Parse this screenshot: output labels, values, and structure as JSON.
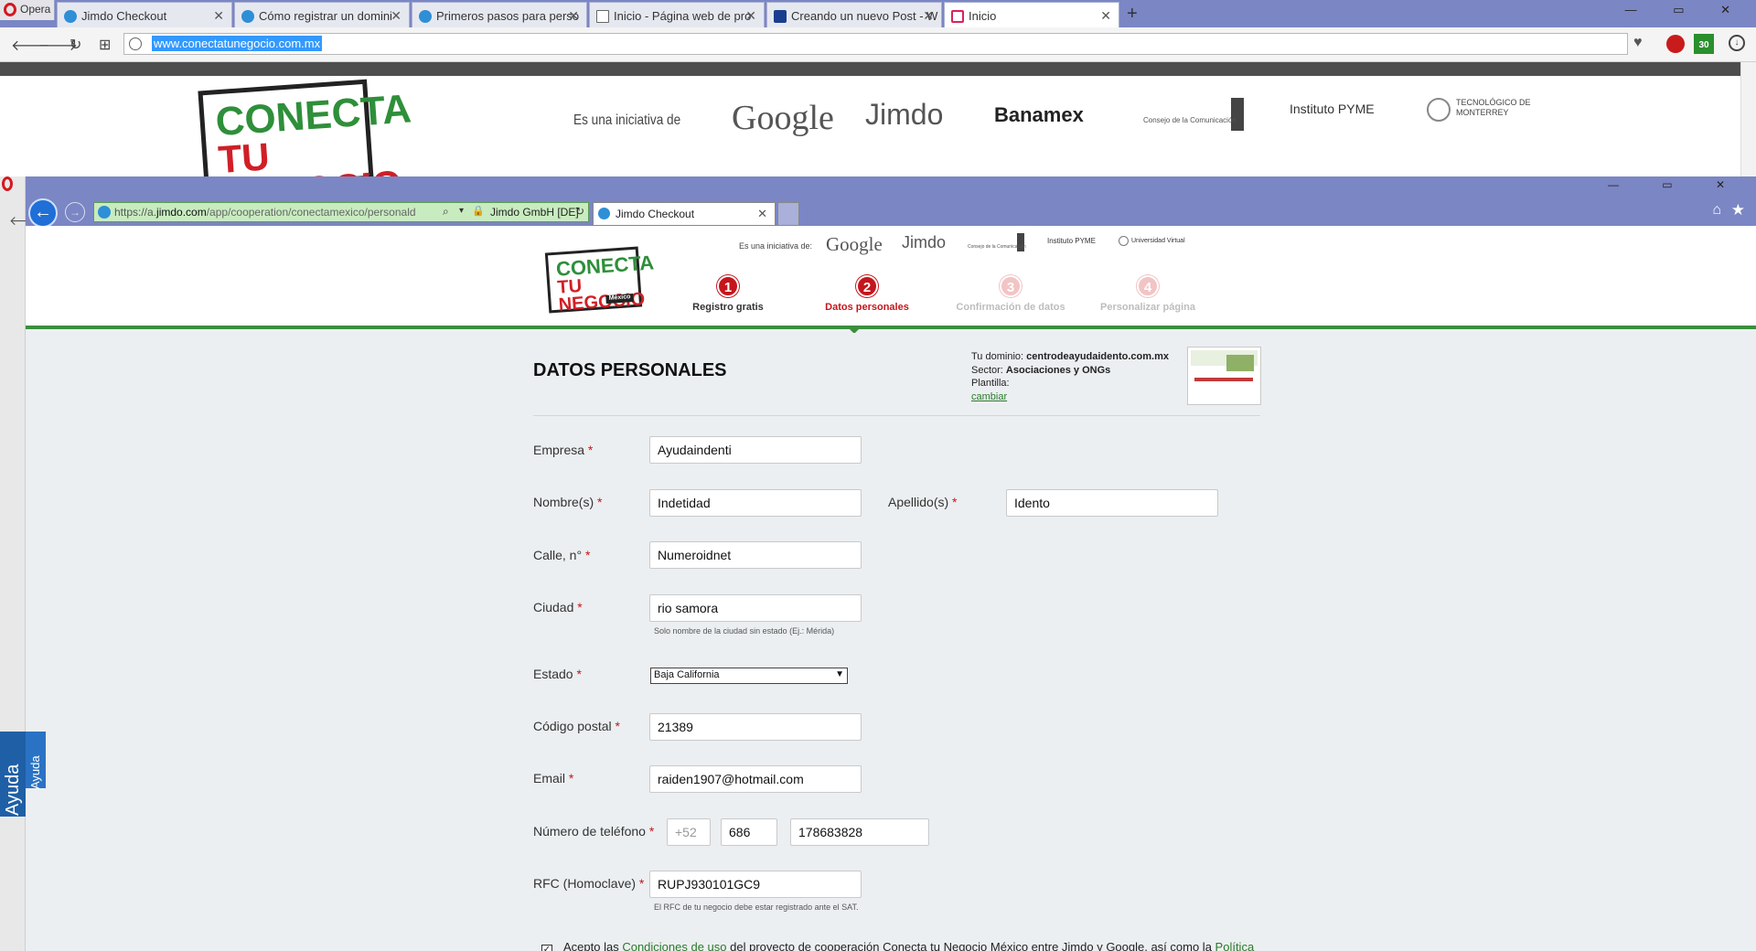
{
  "opera": {
    "menu_label": "Opera",
    "tabs": [
      {
        "label": "Jimdo Checkout",
        "icon": "jimdo-icon"
      },
      {
        "label": "Cómo registrar un domini",
        "icon": "jimdo-icon"
      },
      {
        "label": "Primeros pasos para perso",
        "icon": "jimdo-icon"
      },
      {
        "label": "Inicio - Página web de pro",
        "icon": "document-icon"
      },
      {
        "label": "Creando un nuevo Post - W",
        "icon": "blogger-icon"
      },
      {
        "label": "Inicio",
        "icon": "page-icon"
      }
    ],
    "new_tab": "+",
    "window_controls": "— ▭ ✕",
    "url": "www.conectatunegocio.com.mx",
    "ext_badge": "30"
  },
  "outer_page": {
    "logo_line1": "CONECTA",
    "logo_line2": "TU NEGOCIO",
    "initiative": "Es una iniciativa de",
    "partners": {
      "google": "Google",
      "jimdo": "Jimdo",
      "banamex": "Banamex",
      "consejo": "Consejo de la Comunicación",
      "pyme": "Instituto PYME",
      "tec": "TECNOLÓGICO DE MONTERREY"
    }
  },
  "inner_browser": {
    "window_controls": "— ▭ ✕",
    "url_prefix": "https://a.",
    "url_domain": "jimdo.com",
    "url_path": "/app/cooperation/conectamexico/personald",
    "cert": "Jimdo GmbH [DE]",
    "tab_title": "Jimdo Checkout"
  },
  "checkout": {
    "logo_line1": "CONECTA",
    "logo_line2": "TU NEGOCIO",
    "logo_country": "México",
    "initiative": "Es una iniciativa de:",
    "partners": {
      "google": "Google",
      "jimdo": "Jimdo",
      "consejo": "Consejo de la Comunicación",
      "pyme": "Instituto PYME",
      "univ": "Universidad Virtual"
    },
    "steps": [
      {
        "num": "1",
        "label": "Registro gratis"
      },
      {
        "num": "2",
        "label": "Datos personales"
      },
      {
        "num": "3",
        "label": "Confirmación de datos"
      },
      {
        "num": "4",
        "label": "Personalizar página"
      }
    ],
    "title": "DATOS PERSONALES",
    "summary": {
      "domain_label": "Tu dominio:",
      "domain_value": "centrodeayudaidento.com.mx",
      "sector_label": "Sector:",
      "sector_value": "Asociaciones y ONGs",
      "template_label": "Plantilla:",
      "change_link": "cambiar"
    },
    "form": {
      "company_label": "Empresa",
      "company_value": "Ayudaindenti",
      "first_name_label": "Nombre(s)",
      "first_name_value": "Indetidad",
      "last_name_label": "Apellido(s)",
      "last_name_value": "Idento",
      "street_label": "Calle, n°",
      "street_value": "Numeroidnet",
      "city_label": "Ciudad",
      "city_value": "rio samora",
      "city_hint": "Solo nombre de la ciudad sin estado (Ej.: Mérida)",
      "state_label": "Estado",
      "state_value": "Baja California",
      "zip_label": "Código postal",
      "zip_value": "21389",
      "email_label": "Email",
      "email_value": "raiden1907@hotmail.com",
      "phone_label": "Número de teléfono",
      "phone_prefix": "+52",
      "phone_area": "686",
      "phone_number": "178683828",
      "rfc_label": "RFC (Homoclave)",
      "rfc_value": "RUPJ930101GC9",
      "rfc_hint": "El RFC de tu negocio debe estar registrado ante el SAT.",
      "required_mark": "*"
    },
    "accept": {
      "text1": "Acepto las ",
      "link1": "Condiciones de uso",
      "text2": " del proyecto de cooperación Conecta tu Negocio México entre Jimdo y Google, así como la ",
      "link2": "Política"
    },
    "help_outer": "Ayuda",
    "help_inner": "Ayuda"
  }
}
